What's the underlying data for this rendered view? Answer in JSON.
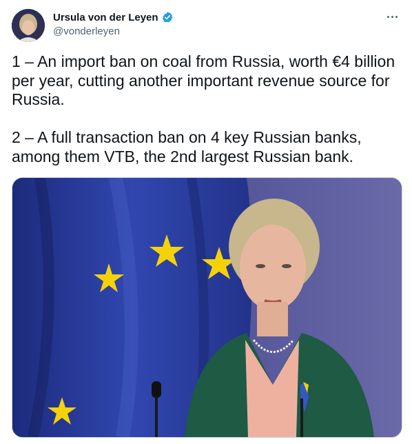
{
  "author": {
    "display_name": "Ursula von der Leyen",
    "handle": "@vonderleyen",
    "verified": true,
    "verified_color": "#1d9bf0"
  },
  "more_icon": "more-horizontal-icon",
  "tweet": {
    "paragraphs": [
      "1 – An import ban on coal from Russia, worth €4 billion per year, cutting another important revenue source for Russia.",
      "2 – A full transaction ban on 4 key Russian banks, among them VTB, the 2nd largest Russian bank."
    ]
  },
  "media": {
    "kind": "photo",
    "colors": {
      "flag_blue": "#2a3a9a",
      "star_yellow": "#f4d20a",
      "jacket_green": "#1e5a44",
      "backdrop": "#4d4f86"
    }
  }
}
